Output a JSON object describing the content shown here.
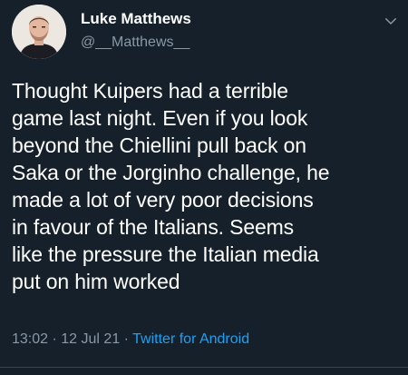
{
  "tweet": {
    "author": {
      "display_name": "Luke Matthews",
      "handle": "@__Matthews__"
    },
    "text": "Thought Kuipers had a terrible\ngame last night. Even if you look\nbeyond the Chiellini pull back on\nSaka or the Jorginho challenge, he\nmade a lot of very poor decisions\nin favour of the Italians. Seems\nlike the pressure the Italian media\nput on him worked",
    "time": "13:02",
    "separator": "·",
    "date": "12 Jul 21",
    "source": "Twitter for Android"
  },
  "icons": {
    "menu": "chevron-down-icon",
    "avatar": "profile-photo"
  },
  "colors": {
    "background": "#15202b",
    "primary_text": "#ffffff",
    "secondary_text": "#8899a6",
    "link": "#1da1f2"
  }
}
